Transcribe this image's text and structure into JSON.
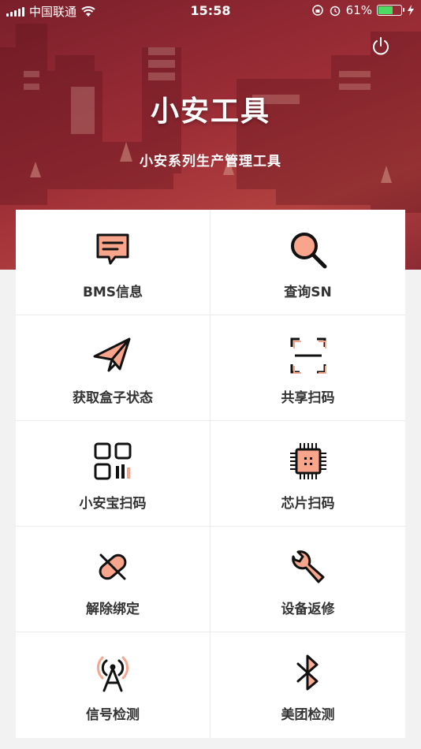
{
  "status_bar": {
    "carrier": "中国联通",
    "time": "15:58",
    "battery_percent": "61%",
    "battery_level": 0.61
  },
  "header": {
    "title": "小安工具",
    "subtitle": "小安系列生产管理工具",
    "power_icon": "power-icon"
  },
  "colors": {
    "hero": "#9c2d36",
    "accent": "#f8a58c",
    "text": "#333333"
  },
  "menu": [
    {
      "label": "BMS信息",
      "icon": "message-icon"
    },
    {
      "label": "查询SN",
      "icon": "search-icon"
    },
    {
      "label": "获取盒子状态",
      "icon": "paper-plane-icon"
    },
    {
      "label": "共享扫码",
      "icon": "scan-icon"
    },
    {
      "label": "小安宝扫码",
      "icon": "qr-code-icon"
    },
    {
      "label": "芯片扫码",
      "icon": "chip-icon"
    },
    {
      "label": "解除绑定",
      "icon": "unlink-icon"
    },
    {
      "label": "设备返修",
      "icon": "wrench-icon"
    },
    {
      "label": "信号检测",
      "icon": "signal-tower-icon"
    },
    {
      "label": "美团检测",
      "icon": "bluetooth-icon"
    }
  ]
}
